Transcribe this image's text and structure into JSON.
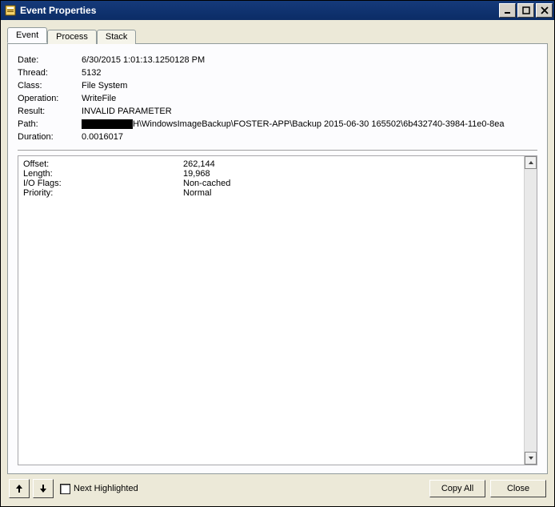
{
  "window": {
    "title": "Event Properties"
  },
  "tabs": {
    "event": "Event",
    "process": "Process",
    "stack": "Stack"
  },
  "summary": {
    "date_label": "Date:",
    "date_value": "6/30/2015 1:01:13.1250128 PM",
    "thread_label": "Thread:",
    "thread_value": "5132",
    "class_label": "Class:",
    "class_value": "File System",
    "operation_label": "Operation:",
    "operation_value": "WriteFile",
    "result_label": "Result:",
    "result_value": "INVALID PARAMETER",
    "path_label": "Path:",
    "path_suffix": "H\\WindowsImageBackup\\FOSTER-APP\\Backup 2015-06-30 165502\\6b432740-3984-11e0-8ea",
    "duration_label": "Duration:",
    "duration_value": "0.0016017"
  },
  "details": {
    "offset_label": "Offset:",
    "offset_value": "262,144",
    "length_label": "Length:",
    "length_value": "19,968",
    "ioflags_label": "I/O Flags:",
    "ioflags_value": "Non-cached",
    "priority_label": "Priority:",
    "priority_value": "Normal"
  },
  "footer": {
    "next_highlighted": "Next Highlighted",
    "copy_all": "Copy All",
    "close": "Close"
  }
}
